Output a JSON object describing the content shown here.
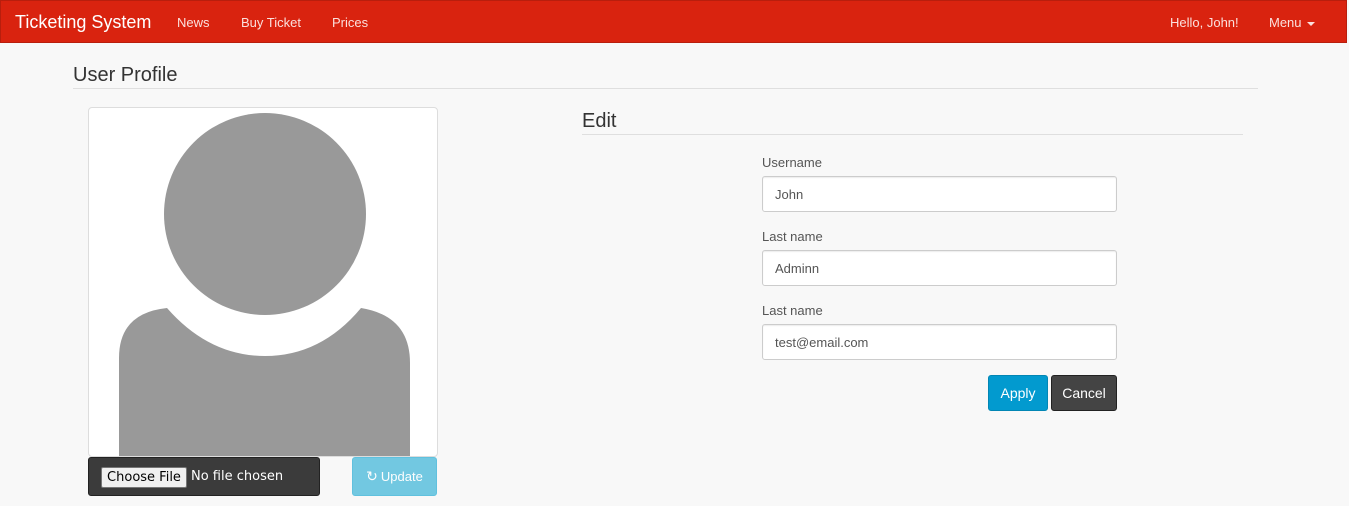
{
  "navbar": {
    "brand": "Ticketing System",
    "links": [
      {
        "label": "News"
      },
      {
        "label": "Buy Ticket"
      },
      {
        "label": "Prices"
      }
    ],
    "greeting": "Hello, John!",
    "menu_label": "Menu",
    "color": "#d9230f"
  },
  "page": {
    "title": "User Profile"
  },
  "avatar": {
    "file_button": "Choose File",
    "file_status": "No file chosen",
    "update_label": "Update",
    "update_icon": "refresh-icon"
  },
  "edit": {
    "title": "Edit",
    "fields": [
      {
        "label": "Username",
        "value": "John"
      },
      {
        "label": "Last name",
        "value": "Adminn"
      },
      {
        "label": "Last name",
        "value": "test@email.com"
      }
    ],
    "apply_label": "Apply",
    "cancel_label": "Cancel"
  }
}
